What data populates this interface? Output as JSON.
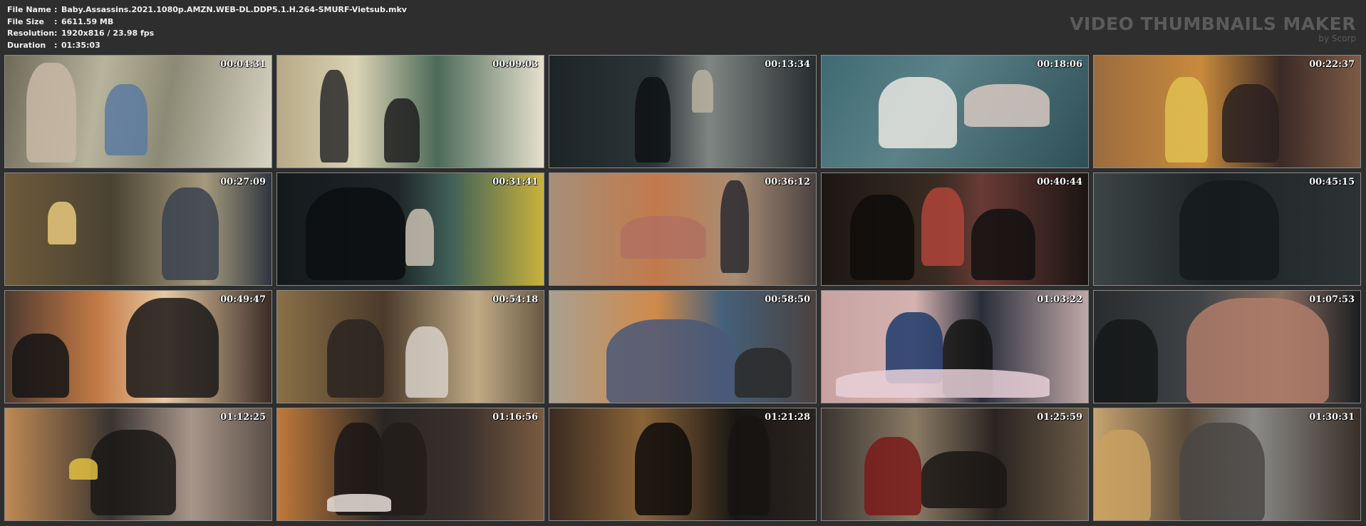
{
  "file_info": {
    "rows": [
      {
        "key": "File Name",
        "value": "Baby.Assassins.2021.1080p.AMZN.WEB-DL.DDP5.1.H.264-SMURF-Vietsub.mkv"
      },
      {
        "key": "File Size",
        "value": "6611.59 MB"
      },
      {
        "key": "Resolution",
        "value": "1920x816 / 23.98 fps"
      },
      {
        "key": "Duration",
        "value": "01:35:03"
      }
    ],
    "separator": ":"
  },
  "brand": {
    "title": "VIDEO THUMBNAILS MAKER",
    "subtitle": "by Scorp"
  },
  "thumbnails": [
    {
      "time": "00:04:31",
      "bg": "linear-gradient(100deg,#6f6a58 0%,#b8b39c 35%,#8c8a74 60%,#d8d4c4 100%)"
    },
    {
      "time": "00:09:03",
      "bg": "linear-gradient(90deg,#b8aa86 0%,#d9d2b4 30%,#4c6a58 60%,#e6e0ce 100%)"
    },
    {
      "time": "00:13:34",
      "bg": "linear-gradient(90deg,#1d2426 0%,#2c3538 40%,#7f8582 60%,#262d30 100%)"
    },
    {
      "time": "00:18:06",
      "bg": "linear-gradient(120deg,#3f6a73 0%,#5b8288 40%,#2e4e56 100%)"
    },
    {
      "time": "00:22:37",
      "bg": "linear-gradient(90deg,#9a6c3e 0%,#c98a3c 40%,#3b2a26 70%,#7d5a44 100%)"
    },
    {
      "time": "00:27:09",
      "bg": "linear-gradient(90deg,#6e5a3a 0%,#4a4232 40%,#a59a7c 75%,#2f3540 100%)"
    },
    {
      "time": "00:31:41",
      "bg": "linear-gradient(90deg,#14191c 0%,#1f2528 45%,#3f6058 65%,#c9b23c 100%)"
    },
    {
      "time": "00:36:12",
      "bg": "linear-gradient(90deg,#a68f78 0%,#c27a4c 40%,#a88c74 70%,#4a4240 100%)"
    },
    {
      "time": "00:40:44",
      "bg": "linear-gradient(90deg,#1c1714 0%,#3a2c22 45%,#6a3a36 60%,#1a1512 100%)"
    },
    {
      "time": "00:45:15",
      "bg": "linear-gradient(90deg,#3c4446 0%,#1e2426 45%,#2c3335 100%)"
    },
    {
      "time": "00:49:47",
      "bg": "linear-gradient(90deg,#4f3a30 0%,#c47a44 35%,#e6c8a2 60%,#3a2c26 100%)"
    },
    {
      "time": "00:54:18",
      "bg": "linear-gradient(90deg,#8a7048 0%,#4a3a2a 40%,#c0aa86 75%,#6a5a44 100%)"
    },
    {
      "time": "00:58:50",
      "bg": "linear-gradient(90deg,#a8a090 0%,#d08a4a 40%,#45607a 65%,#4a4240 100%)"
    },
    {
      "time": "01:03:22",
      "bg": "linear-gradient(90deg,#c8a2a0 0%,#d4b2b0 35%,#2a2e3a 60%,#c0a8a8 100%)"
    },
    {
      "time": "01:07:53",
      "bg": "linear-gradient(90deg,#2a2c2e 0%,#404446 40%,#8a6e62 70%,#1c1e20 100%)"
    },
    {
      "time": "01:12:25",
      "bg": "linear-gradient(90deg,#c08a54 0%,#3a3430 40%,#a8968a 70%,#5a4e46 100%)"
    },
    {
      "time": "01:16:56",
      "bg": "linear-gradient(90deg,#c07a3c 0%,#2a2624 40%,#3a302c 70%,#7a5a40 100%)"
    },
    {
      "time": "01:21:28",
      "bg": "linear-gradient(90deg,#3a2a20 0%,#8a6438 35%,#1a1614 70%,#2a2420 100%)"
    },
    {
      "time": "01:25:59",
      "bg": "linear-gradient(90deg,#3a3430 0%,#8a7a64 35%,#2a2420 65%,#6a5a48 100%)"
    },
    {
      "time": "01:30:31",
      "bg": "linear-gradient(90deg,#c8a470 0%,#5a4a3a 35%,#8a8a88 60%,#3a3028 100%)"
    }
  ]
}
